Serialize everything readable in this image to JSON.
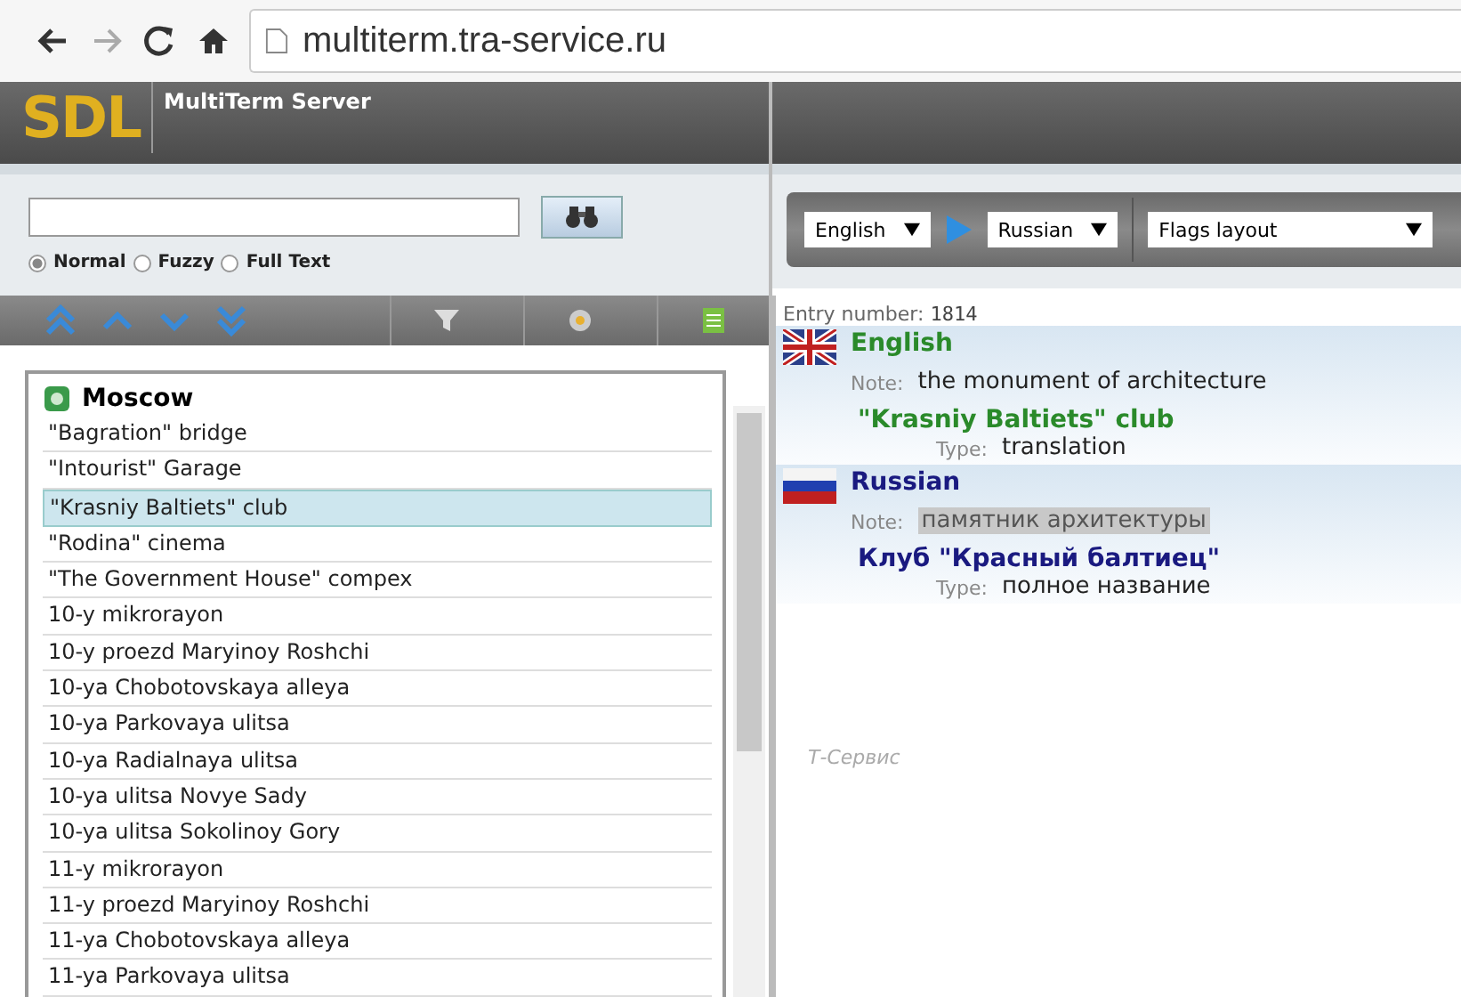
{
  "browser": {
    "url": "multiterm.tra-service.ru"
  },
  "header": {
    "logo": "SDL",
    "product": "MultiTerm Server"
  },
  "search": {
    "modes": [
      {
        "label": "Normal",
        "selected": true
      },
      {
        "label": "Fuzzy",
        "selected": false
      },
      {
        "label": "Full Text",
        "selected": false
      }
    ]
  },
  "termbase": {
    "title": "Moscow",
    "terms": [
      {
        "label": "\"Bagration\" bridge",
        "selected": false
      },
      {
        "label": "\"Intourist\" Garage",
        "selected": false
      },
      {
        "label": "\"Krasniy Baltiets\" club",
        "selected": true
      },
      {
        "label": "\"Rodina\" cinema",
        "selected": false
      },
      {
        "label": "\"The Government House\" compex",
        "selected": false
      },
      {
        "label": "10-y mikrorayon",
        "selected": false
      },
      {
        "label": "10-y proezd Maryinoy Roshchi",
        "selected": false
      },
      {
        "label": "10-ya Chobotovskaya alleya",
        "selected": false
      },
      {
        "label": "10-ya Parkovaya ulitsa",
        "selected": false
      },
      {
        "label": "10-ya Radialnaya ulitsa",
        "selected": false
      },
      {
        "label": "10-ya ulitsa Novye Sady",
        "selected": false
      },
      {
        "label": "10-ya ulitsa Sokolinoy Gory",
        "selected": false
      },
      {
        "label": "11-y mikrorayon",
        "selected": false
      },
      {
        "label": "11-y proezd Maryinoy Roshchi",
        "selected": false
      },
      {
        "label": "11-ya Chobotovskaya alleya",
        "selected": false
      },
      {
        "label": "11-ya Parkovaya ulitsa",
        "selected": false
      }
    ]
  },
  "toolbar": {
    "source": "English",
    "target": "Russian",
    "layout": "Flags layout"
  },
  "entry": {
    "number_label": "Entry number:",
    "number": "1814",
    "languages": [
      {
        "kind": "uk",
        "name": "English",
        "color": "#2a8a2a",
        "note_label": "Note:",
        "note": "the monument of architecture",
        "note_highlighted": false,
        "term": "\"Krasniy Baltiets\" club",
        "type_label": "Type:",
        "type": "translation"
      },
      {
        "kind": "ru",
        "name": "Russian",
        "color": "#1a1a80",
        "note_label": "Note:",
        "note": "памятник архитектуры",
        "note_highlighted": true,
        "term": "Клуб \"Красный балтиец\"",
        "type_label": "Type:",
        "type": "полное название"
      }
    ],
    "footer": "Т-Сервис"
  }
}
